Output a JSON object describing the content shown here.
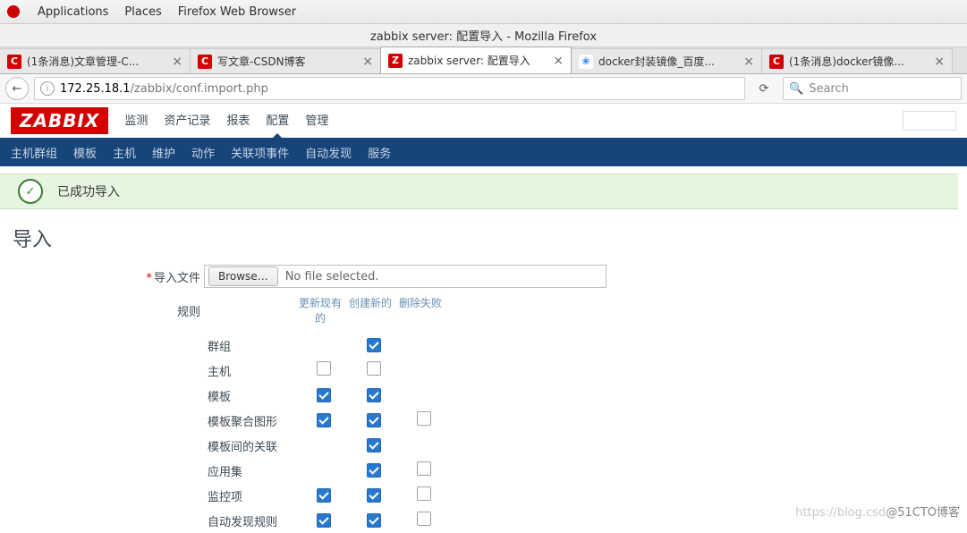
{
  "gnome": {
    "apps": "Applications",
    "places": "Places",
    "browser": "Firefox Web Browser"
  },
  "firefox": {
    "window_title": "zabbix server: 配置导入 - Mozilla Firefox",
    "back_glyph": "←",
    "info_glyph": "i",
    "url_host": "172.25.18.1",
    "url_path": "/zabbix/conf.import.php",
    "reload_glyph": "⟳",
    "search_icon": "🔍",
    "search_placeholder": "Search",
    "tabs": [
      {
        "favicon_bg": "#d40000",
        "favicon_color": "#fff",
        "favicon_text": "C",
        "label": "(1条消息)文章管理-C...",
        "active": false
      },
      {
        "favicon_bg": "#d40000",
        "favicon_color": "#fff",
        "favicon_text": "C",
        "label": "写文章-CSDN博客",
        "active": false
      },
      {
        "favicon_bg": "#d40000",
        "favicon_color": "#fff",
        "favicon_text": "Z",
        "label": "zabbix server: 配置导入",
        "active": true
      },
      {
        "favicon_bg": "#fff",
        "favicon_color": "#3385ff",
        "favicon_text": "❀",
        "label": "docker封装镜像_百度...",
        "active": false
      },
      {
        "favicon_bg": "#d40000",
        "favicon_color": "#fff",
        "favicon_text": "C",
        "label": "(1条消息)docker镜像...",
        "active": false
      }
    ]
  },
  "zabbix": {
    "logo": "ZABBIX",
    "menu": [
      {
        "label": "监测",
        "active": false
      },
      {
        "label": "资产记录",
        "active": false
      },
      {
        "label": "报表",
        "active": false
      },
      {
        "label": "配置",
        "active": true
      },
      {
        "label": "管理",
        "active": false
      }
    ],
    "submenu": [
      "主机群组",
      "模板",
      "主机",
      "维护",
      "动作",
      "关联项事件",
      "自动发现",
      "服务"
    ],
    "success_msg": "已成功导入",
    "check_glyph": "✓",
    "page_title": "导入",
    "form": {
      "import_file_label": "导入文件",
      "browse_label": "Browse…",
      "no_file": "No file selected.",
      "rules_label": "规则",
      "headers": {
        "update": "更新现有的",
        "create": "创建新的",
        "delete": "删除失败"
      },
      "rows": [
        {
          "name": "群组",
          "update": null,
          "create": true,
          "delete": null
        },
        {
          "name": "主机",
          "update": false,
          "create": false,
          "delete": null
        },
        {
          "name": "模板",
          "update": true,
          "create": true,
          "delete": null
        },
        {
          "name": "模板聚合图形",
          "update": true,
          "create": true,
          "delete": false
        },
        {
          "name": "模板间的关联",
          "update": null,
          "create": true,
          "delete": null
        },
        {
          "name": "应用集",
          "update": null,
          "create": true,
          "delete": false
        },
        {
          "name": "监控项",
          "update": true,
          "create": true,
          "delete": false
        },
        {
          "name": "自动发现规则",
          "update": true,
          "create": true,
          "delete": false
        }
      ]
    }
  },
  "watermark": {
    "light": "https://blog.csd",
    "dark": "@51CTO博客"
  }
}
